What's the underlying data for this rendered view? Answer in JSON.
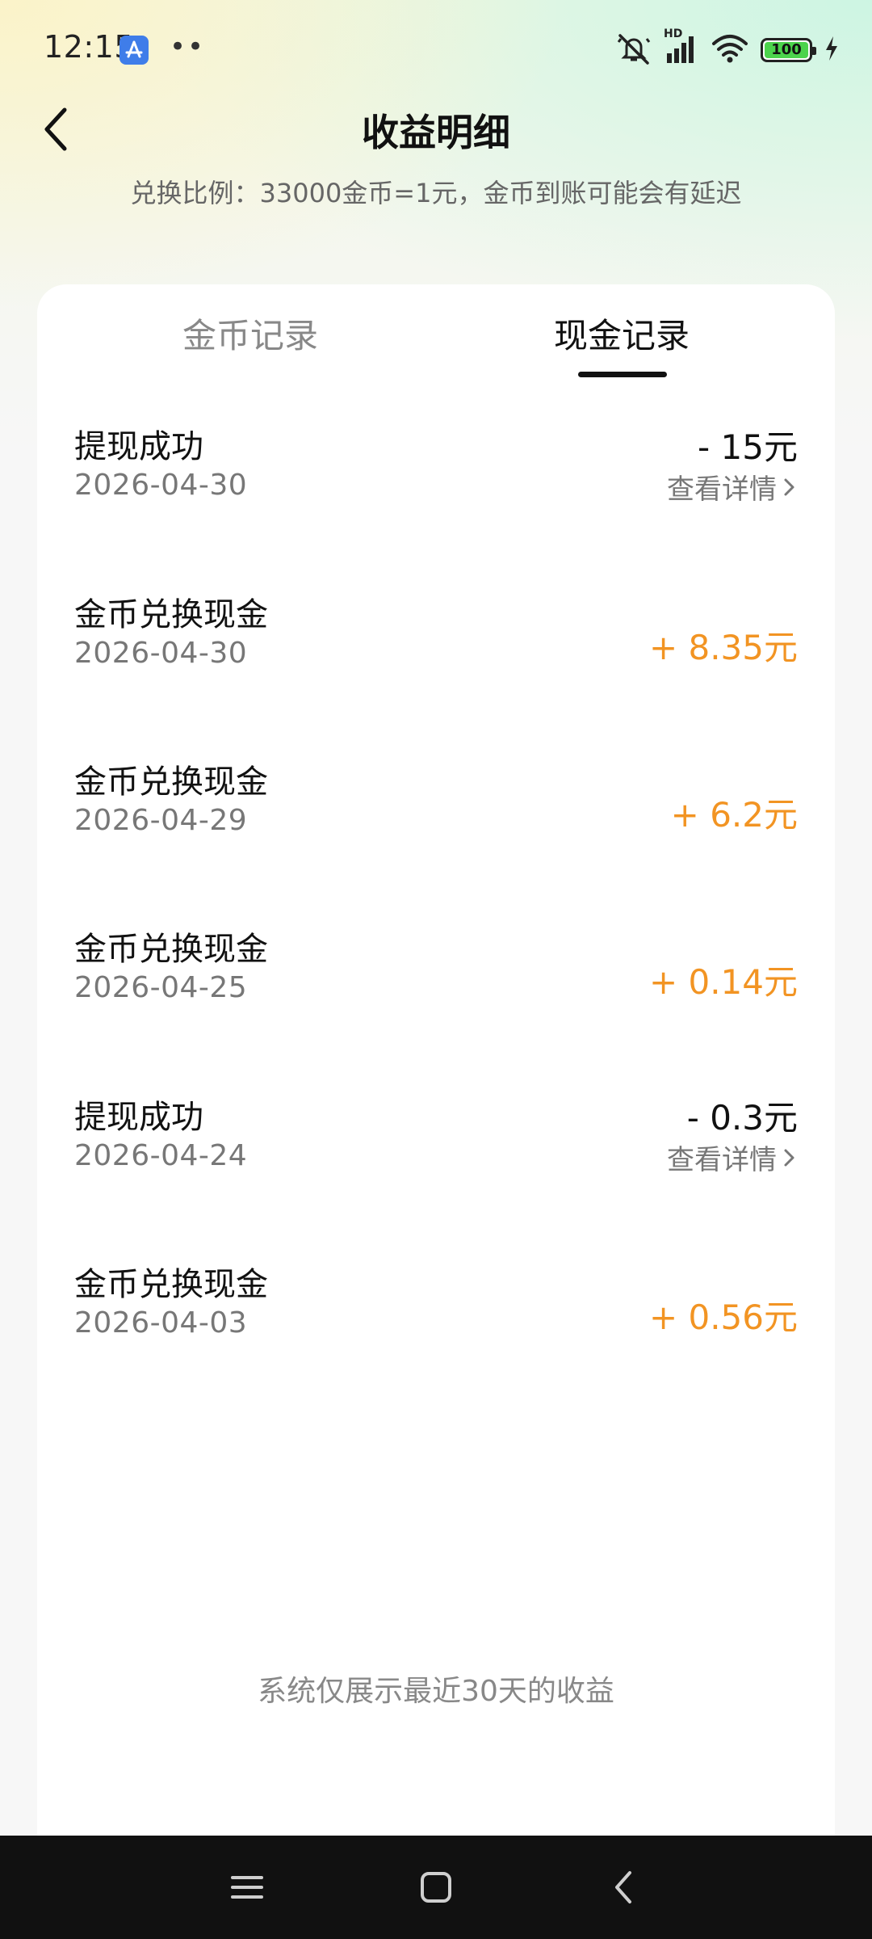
{
  "status_bar": {
    "time": "12:15",
    "dots": "••",
    "network": "HD",
    "battery": "100"
  },
  "header": {
    "title": "收益明细",
    "subtitle": "兑换比例：33000金币=1元，金币到账可能会有延迟"
  },
  "tabs": [
    {
      "label": "金币记录",
      "active": false
    },
    {
      "label": "现金记录",
      "active": true
    }
  ],
  "records": [
    {
      "title": "提现成功",
      "date": "2026-04-30",
      "amount": "- 15元",
      "detail": "查看详情"
    },
    {
      "title": "金币兑换现金",
      "date": "2026-04-30",
      "amount": "+ 8.35元"
    },
    {
      "title": "金币兑换现金",
      "date": "2026-04-29",
      "amount": "+ 6.2元"
    },
    {
      "title": "金币兑换现金",
      "date": "2026-04-25",
      "amount": "+ 0.14元"
    },
    {
      "title": "提现成功",
      "date": "2026-04-24",
      "amount": "- 0.3元",
      "detail": "查看详情"
    },
    {
      "title": "金币兑换现金",
      "date": "2026-04-03",
      "amount": "+ 0.56元"
    }
  ],
  "footer_note": "系统仅展示最近30天的收益",
  "colors": {
    "positive_amount": "#f29423",
    "negative_amount": "#111111",
    "tab_active": "#111111",
    "tab_inactive": "#888888"
  }
}
